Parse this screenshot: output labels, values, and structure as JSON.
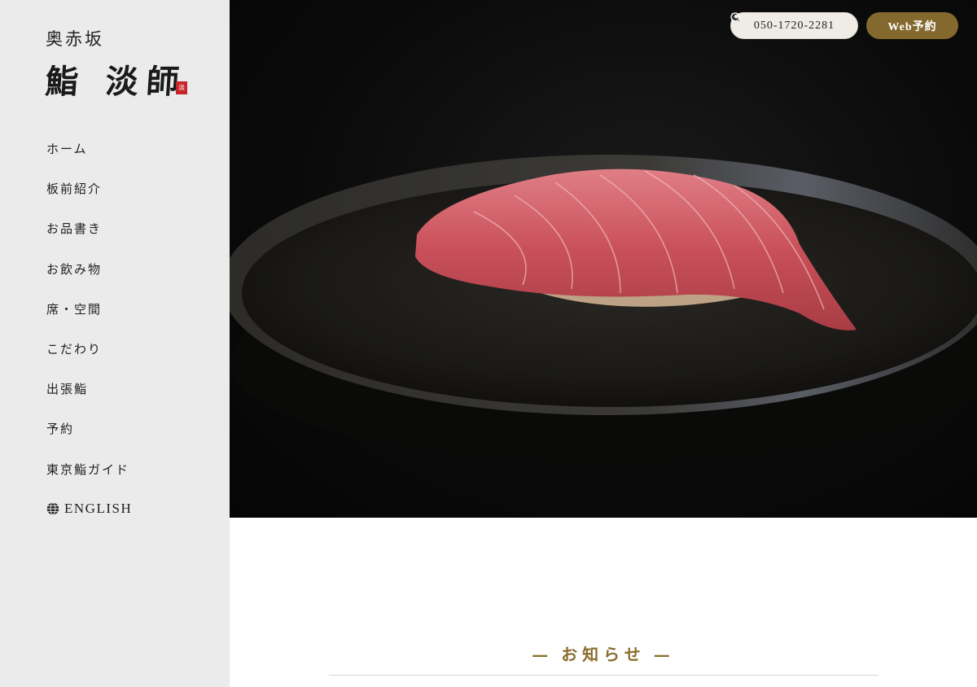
{
  "brand": {
    "area": "奥赤坂",
    "name": "鮨 淡師",
    "seal": "淡"
  },
  "nav": {
    "items": [
      "ホーム",
      "板前紹介",
      "お品書き",
      "お飲み物",
      "席・空間",
      "こだわり",
      "出張鮨",
      "予約",
      "東京鮨ガイド"
    ],
    "english": "ENGLISH"
  },
  "header": {
    "phone": "050-1720-2281",
    "web_reserve": "Web予約"
  },
  "news": {
    "title": "お知らせ",
    "dash": "—"
  },
  "colors": {
    "accent": "#84692f",
    "sidebar_bg": "#ebebeb",
    "heading_gold": "#8a6d2e"
  },
  "icons": {
    "phone": "phone-icon",
    "clock": "clock-icon",
    "globe": "globe-icon"
  }
}
